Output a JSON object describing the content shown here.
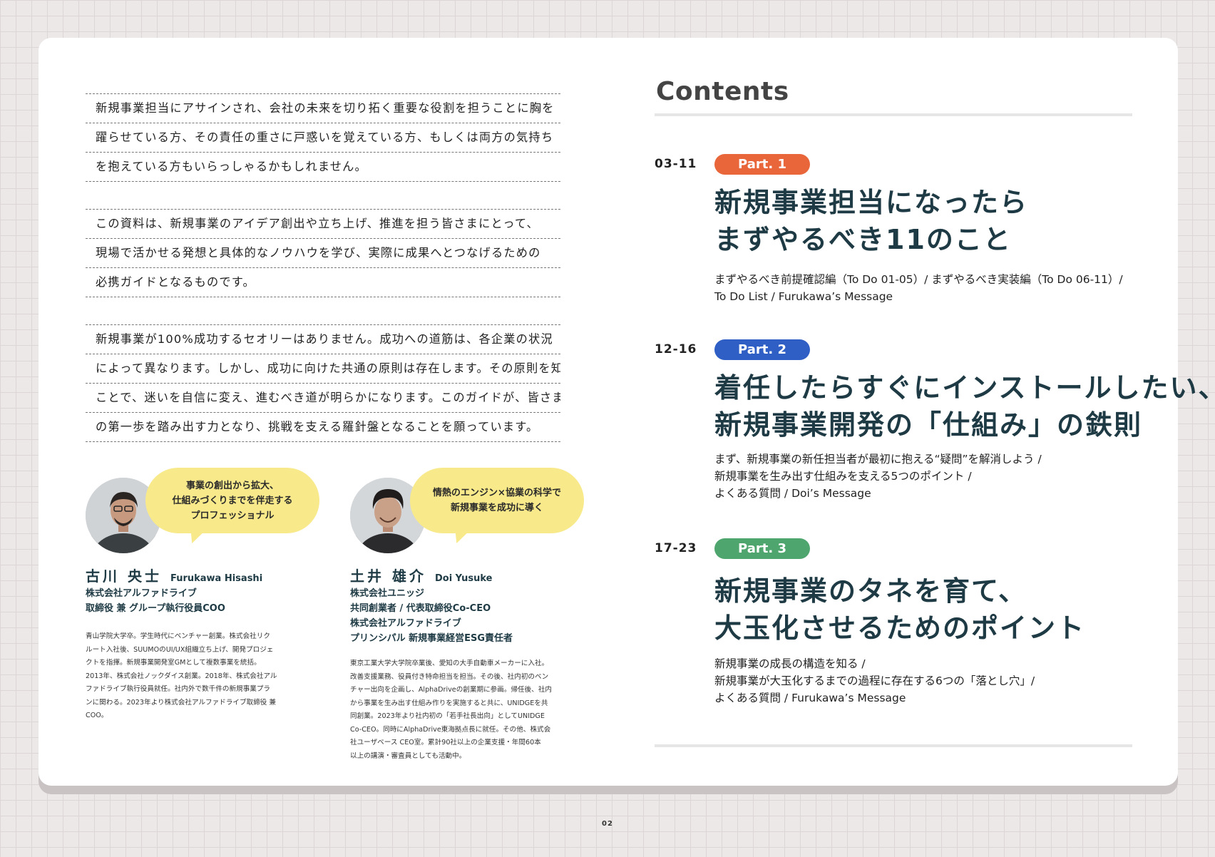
{
  "intro": {
    "paragraphs": [
      [
        "新規事業担当にアサインされ、会社の未来を切り拓く重要な役割を担うことに胸を",
        "躍らせている方、その責任の重さに戸惑いを覚えている方、もしくは両方の気持ち",
        "を抱えている方もいらっしゃるかもしれません。"
      ],
      [
        "この資料は、新規事業のアイデア創出や立ち上げ、推進を担う皆さまにとって、",
        "現場で活かせる発想と具体的なノウハウを学び、実際に成果へとつなげるための",
        "必携ガイドとなるものです。"
      ],
      [
        "新規事業が100%成功するセオリーはありません。成功への道筋は、各企業の状況",
        "によって異なります。しかし、成功に向けた共通の原則は存在します。その原則を知る",
        "ことで、迷いを自信に変え、進むべき道が明らかになります。このガイドが、皆さま",
        "の第一歩を踏み出す力となり、挑戦を支える羅針盤となることを願っています。"
      ]
    ]
  },
  "people": [
    {
      "bubble": [
        "事業の創出から拡大、",
        "仕組みづくりまでを伴走する",
        "プロフェッショナル"
      ],
      "name_ja": "古川 央士",
      "name_en": "Furukawa Hisashi",
      "roles": [
        "株式会社アルファドライブ",
        "取締役 兼 グループ執行役員COO"
      ],
      "bio": [
        "青山学院大学卒。学生時代にベンチャー創業。株式会社リク",
        "ルート入社後、SUUMOのUI/UX組織立ち上げ、開発プロジェ",
        "クトを指揮。新規事業開発室GMとして複数事業を統括。",
        "2013年、株式会社ノックダイス創業。2018年、株式会社アル",
        "ファドライブ執行役員就任。社内外で数千件の新規事業プラ",
        "ンに関わる。2023年より株式会社アルファドライブ取締役 兼",
        "COO。"
      ]
    },
    {
      "bubble": [
        "情熱のエンジン×協業の科学で",
        "新規事業を成功に導く"
      ],
      "name_ja": "土井 雄介",
      "name_en": "Doi Yusuke",
      "roles": [
        "株式会社ユニッジ",
        "共同創業者 / 代表取締役Co-CEO",
        "株式会社アルファドライブ",
        "プリンシパル 新規事業経営ESG責任者"
      ],
      "bio": [
        "東京工業大学大学院卒業後、愛知の大手自動車メーカーに入社。",
        "改善支援業務、役員付き特命担当を担当。その後、社内初のベン",
        "チャー出向を企画し、AlphaDriveの創業期に参画。帰任後、社内",
        "から事業を生み出す仕組み作りを実施すると共に、UNIDGEを共",
        "同創業。2023年より社内初の「若手社長出向」としてUNIDGE",
        "Co-CEO。同時にAlphaDrive東海拠点長に就任。その他、株式会",
        "社ユーザベース CEO室。累計90社以上の企業支援・年間60本",
        "以上の講演・審査員としても活動中。"
      ]
    }
  ],
  "contents": {
    "title": "Contents",
    "parts": [
      {
        "pages": "03-11",
        "label": "Part. 1",
        "color": "#e8663a",
        "title": [
          "新規事業担当になったら",
          "まずやるべき11のこと"
        ],
        "desc": [
          "まずやるべき前提確認編（To Do 01-05）/ まずやるべき実装編（To Do 06-11）/",
          "To Do List / Furukawa’s Message"
        ]
      },
      {
        "pages": "12-16",
        "label": "Part. 2",
        "color": "#2f5fc4",
        "title": [
          "着任したらすぐにインストールしたい、",
          "新規事業開発の「仕組み」の鉄則"
        ],
        "desc": [
          "まず、新規事業の新任担当者が最初に抱える“疑問”を解消しよう /",
          "新規事業を生み出す仕組みを支える5つのポイント /",
          "よくある質問 / Doi’s Message"
        ]
      },
      {
        "pages": "17-23",
        "label": "Part. 3",
        "color": "#4ea66e",
        "title": [
          "新規事業のタネを育て、",
          "大玉化させるためのポイント"
        ],
        "desc": [
          "新規事業の成長の構造を知る /",
          "新規事業が大玉化するまでの過程に存在する6つの「落とし穴」/",
          "よくある質問 / Furukawa’s Message"
        ]
      }
    ]
  },
  "page_number": "02"
}
